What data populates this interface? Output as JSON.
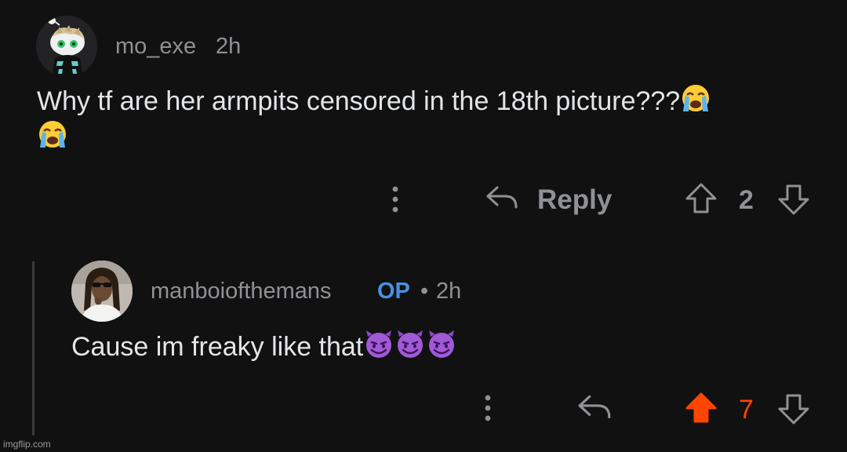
{
  "comments": [
    {
      "username": "mo_exe",
      "time": "2h",
      "text_line1": "Why tf are her armpits censored in the 18th picture???",
      "emoji": "loudly-crying-face",
      "actions": {
        "more_icon": "more-vertical-icon",
        "reply_icon": "reply-arrow-icon",
        "reply_label": "Reply",
        "upvote_icon": "upvote-arrow-icon",
        "score": "2",
        "downvote_icon": "downvote-arrow-icon",
        "upvoted": false
      }
    },
    {
      "username": "manboiofthemans",
      "op_badge": "OP",
      "separator": "•",
      "time": "2h",
      "text": "Cause im freaky like that",
      "emoji": "smiling-face-with-horns",
      "emoji_count": 3,
      "actions": {
        "more_icon": "more-vertical-icon",
        "reply_icon": "reply-arrow-icon",
        "upvote_icon": "upvote-arrow-filled-icon",
        "score": "7",
        "downvote_icon": "downvote-arrow-icon",
        "upvoted": true
      }
    }
  ],
  "colors": {
    "background": "#111112",
    "muted_text": "#8f9194",
    "upvote_active": "#ff4500",
    "op_badge": "#4a90e2",
    "thread_line": "#3a3a3c"
  },
  "watermark": "imgflip.com"
}
